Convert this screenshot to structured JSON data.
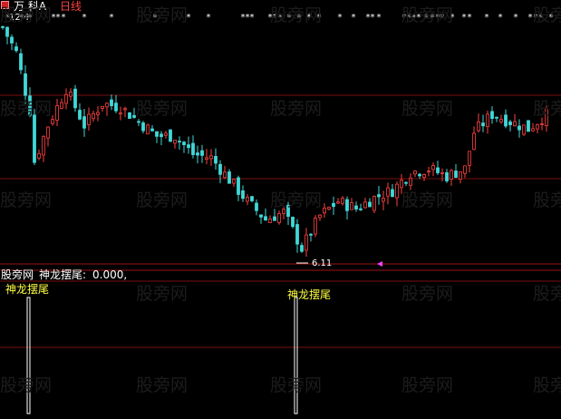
{
  "header": {
    "stock_name": "万 科A",
    "period": "日线"
  },
  "indicator": {
    "source": "股旁网",
    "name": "神龙摆尾:",
    "value": "0.000,",
    "signal_label": "神龙摆尾"
  },
  "watermark": "股旁网",
  "colors": {
    "background": "#000000",
    "up": "#ff4040",
    "down": "#40d8d8",
    "grid": "#7a1010",
    "signal": "#ffff40",
    "text": "#ffffff",
    "marker": "#ff40ff"
  },
  "chart_data": {
    "type": "candlestick",
    "period": "日线",
    "max_label": "12.4",
    "min_label": "6.11",
    "ylim": [
      5.8,
      12.6
    ],
    "grid": true,
    "indicator": {
      "name": "神龙摆尾",
      "value": 0.0,
      "signal_label": "神龙摆尾",
      "signals_at_bar_index": [
        5,
        64
      ]
    }
  }
}
